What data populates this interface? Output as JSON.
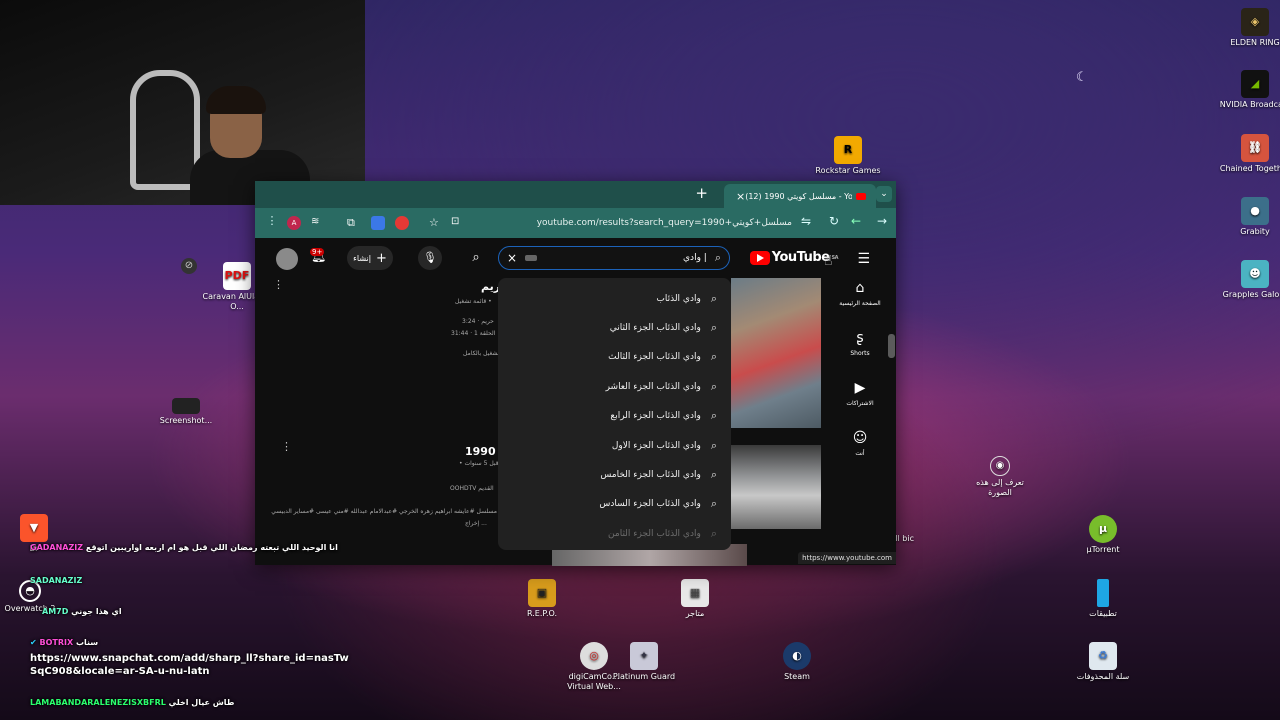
{
  "webcam": {
    "label": ""
  },
  "desktop_icons": [
    {
      "id": "elden",
      "label": "ELDEN RING"
    },
    {
      "id": "nvidia",
      "label": "NVIDIA Broadcast"
    },
    {
      "id": "chained",
      "label": "Chained Together"
    },
    {
      "id": "grabity",
      "label": "Grabity"
    },
    {
      "id": "grapples",
      "label": "Grapples Galore"
    },
    {
      "id": "rockstar",
      "label": "Rockstar Games ..."
    },
    {
      "id": "caravan",
      "label": "Caravan AlUla by O..."
    },
    {
      "id": "screenshot",
      "label": "Screenshot..."
    },
    {
      "id": "learn",
      "label": "تعرف إلى هذه الصورة"
    },
    {
      "id": "utorrent",
      "label": "µTorrent"
    },
    {
      "id": "apps",
      "label": "تطبيقات"
    },
    {
      "id": "recycle",
      "label": "سلة المحذوفات"
    },
    {
      "id": "repo",
      "label": "R.E.P.O."
    },
    {
      "id": "stores",
      "label": "متاجر"
    },
    {
      "id": "digicam",
      "label": "digiCamCo... Virtual Web..."
    },
    {
      "id": "platinum",
      "label": "Platinum Guard"
    },
    {
      "id": "steam",
      "label": "Steam"
    },
    {
      "id": "via",
      "label": "Via_Ill bic"
    },
    {
      "id": "overwatch",
      "label": "Overwatch 2"
    },
    {
      "id": "brave",
      "label": "Br"
    }
  ],
  "browser": {
    "tab_title": "(12) مسلسل كويتي 1990 - YouTube",
    "new_tab": "+",
    "url": "youtube.com/results?search_query=مسلسل+كويتي+1990",
    "status_url": "https://www.youtube.com"
  },
  "youtube": {
    "logo_text": "YouTube",
    "logo_region": "SA",
    "search_value": "وادي |",
    "create_label": "إنشاء",
    "notif_badge": "9+",
    "sidebar": [
      {
        "icon": "home-icon",
        "label": "الصفحة الرئيسية"
      },
      {
        "icon": "shorts-icon",
        "label": "Shorts"
      },
      {
        "icon": "subscriptions-icon",
        "label": "الاشتراكات"
      },
      {
        "icon": "you-icon",
        "label": "أنت"
      }
    ],
    "suggestions": [
      "وادي الذئاب",
      "وادي الذئاب الجزء الثاني",
      "وادي الذئاب الجزء الثالث",
      "وادي الذئاب الجزء العاشر",
      "وادي الذئاب الجزء الرابع",
      "وادي الذئاب الجزء الاول",
      "وادي الذئاب الجزء الخامس",
      "وادي الذئاب الجزء السادس",
      "وادي الذئاب الجزء الثامن"
    ],
    "video1": {
      "title": "حريم",
      "meta1": "قائمة تشغيل •",
      "meta2": "حريم · 3:24",
      "meta3": "الحلقة 1 · 31:44",
      "meta4": "تشغيل بالكامل"
    },
    "video2": {
      "title": "1990 م",
      "meta1": "• قبل 5 سنوات",
      "channel": "OOHDTV القديم",
      "desc": "مسلسل #عايشه ابراهيم زهره الخرجي #عبدالامام عبدالله #مني عيسى #مساير الدبيسي",
      "desc2": "إخراج ..."
    }
  },
  "chat": [
    {
      "user": "GADANAZIZ",
      "text": "انا الوحيد اللي تبعته رمضان اللي قبل هو ام اربعه اواريبين اتوقع"
    },
    {
      "user": "SADANAZIZ",
      "text": ""
    },
    {
      "user": "AM7D",
      "text": "اي هذا جوني"
    },
    {
      "user": "BOTRIX",
      "text": "سناب"
    },
    {
      "user": "",
      "text": "https://www.snapchat.com/add/sharp_ll?share_id=nasTwSqC908&locale=ar-SA-u-nu-latn"
    },
    {
      "user": "LAMABANDARALENEZISXBFRL",
      "text": "طاش عيال اخلي"
    }
  ]
}
